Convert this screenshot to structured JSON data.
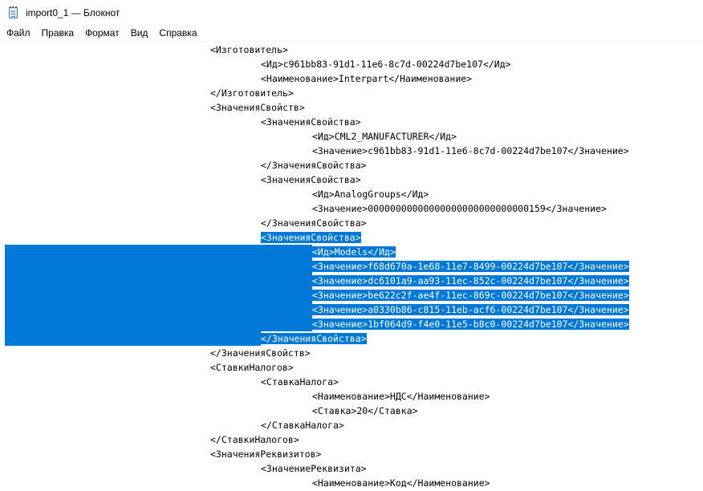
{
  "window": {
    "title": "import0_1 — Блокнот"
  },
  "menu": [
    "Файл",
    "Правка",
    "Формат",
    "Вид",
    "Справка"
  ],
  "editor": {
    "lines": [
      {
        "indent": 1,
        "text": "<Изготовитель>"
      },
      {
        "indent": 2,
        "text": "<Ид>c961bb83-91d1-11e6-8c7d-00224d7be107</Ид>"
      },
      {
        "indent": 2,
        "text": "<Наименование>Interpart</Наименование>"
      },
      {
        "indent": 1,
        "text": "</Изготовитель>"
      },
      {
        "indent": 1,
        "text": "<ЗначенияСвойств>"
      },
      {
        "indent": 2,
        "text": "<ЗначенияСвойства>"
      },
      {
        "indent": 3,
        "text": "<Ид>CML2_MANUFACTURER</Ид>"
      },
      {
        "indent": 3,
        "text": "<Значение>c961bb83-91d1-11e6-8c7d-00224d7be107</Значение>"
      },
      {
        "indent": 2,
        "text": "</ЗначенияСвойства>"
      },
      {
        "indent": 2,
        "text": "<ЗначенияСвойства>"
      },
      {
        "indent": 3,
        "text": "<Ид>AnalogGroups</Ид>"
      },
      {
        "indent": 3,
        "text": "<Значение>00000000000000000000000000000159</Значение>"
      },
      {
        "indent": 2,
        "text": "</ЗначенияСвойства>"
      },
      {
        "indent": 2,
        "text": "<ЗначенияСвойства>",
        "selected": true
      },
      {
        "indent": 3,
        "text": "<Ид>Models</Ид>",
        "selected": true
      },
      {
        "indent": 3,
        "text": "<Значение>f68d670a-1e68-11e7-8499-00224d7be107</Значение>",
        "selected": true
      },
      {
        "indent": 3,
        "text": "<Значение>dc6101a9-aa93-11ec-852c-00224d7be107</Значение>",
        "selected": true
      },
      {
        "indent": 3,
        "text": "<Значение>be622c2f-ae4f-11ec-869c-00224d7be107</Значение>",
        "selected": true
      },
      {
        "indent": 3,
        "text": "<Значение>a0330b86-c815-11eb-acf6-00224d7be107</Значение>",
        "selected": true
      },
      {
        "indent": 3,
        "text": "<Значение>1bf064d9-f4e0-11e5-b8c0-00224d7be107</Значение>",
        "selected": true
      },
      {
        "indent": 2,
        "text": "</ЗначенияСвойства>",
        "selected": true
      },
      {
        "indent": 1,
        "text": "</ЗначенияСвойств>"
      },
      {
        "indent": 1,
        "text": "<СтавкиНалогов>"
      },
      {
        "indent": 2,
        "text": "<СтавкаНалога>"
      },
      {
        "indent": 3,
        "text": "<Наименование>НДС</Наименование>"
      },
      {
        "indent": 3,
        "text": "<Ставка>20</Ставка>"
      },
      {
        "indent": 2,
        "text": "</СтавкаНалога>"
      },
      {
        "indent": 1,
        "text": "</СтавкиНалогов>"
      },
      {
        "indent": 1,
        "text": "<ЗначенияРеквизитов>"
      },
      {
        "indent": 2,
        "text": "<ЗначениеРеквизита>"
      },
      {
        "indent": 3,
        "text": "<Наименование>Код</Наименование>"
      }
    ]
  }
}
